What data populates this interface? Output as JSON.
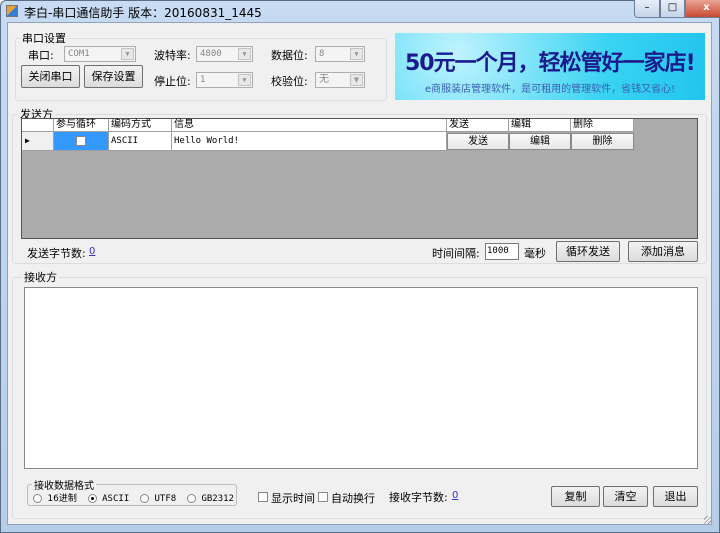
{
  "window": {
    "title": "李白-串口通信助手 版本：20160831_1445",
    "minimize": "–",
    "maximize": "□",
    "close": "x"
  },
  "serial": {
    "group_label": "串口设置",
    "port_label": "串口:",
    "port_value": "COM1",
    "baud_label": "波特率:",
    "baud_value": "4800",
    "databits_label": "数据位:",
    "databits_value": "8",
    "stopbits_label": "停止位:",
    "stopbits_value": "1",
    "parity_label": "校验位:",
    "parity_value": "无",
    "close_port": "关闭串口",
    "save_settings": "保存设置"
  },
  "banner": {
    "headline": "50元一个月，轻松管好一家店!",
    "subline": "e商服装店管理软件，是可租用的管理软件，省钱又省心!"
  },
  "send": {
    "group_label": "发送方",
    "columns": [
      "参与循环",
      "编码方式",
      "信息",
      "发送",
      "编辑",
      "删除"
    ],
    "rows": [
      {
        "loop": false,
        "encoding": "ASCII",
        "message": "Hello World!",
        "send": "发送",
        "edit": "编辑",
        "delete": "删除"
      }
    ],
    "bytes_label": "发送字节数:",
    "bytes_value": "0",
    "interval_label": "时间间隔:",
    "interval_value": "1000",
    "ms_label": "毫秒",
    "loop_send": "循环发送",
    "add_message": "添加消息"
  },
  "receive": {
    "group_label": "接收方",
    "content": "",
    "format_label": "接收数据格式",
    "formats": [
      "16进制",
      "ASCII",
      "UTF8",
      "GB2312"
    ],
    "selected_format": "ASCII",
    "show_time": "显示时间",
    "auto_wrap": "自动换行",
    "bytes_label": "接收字节数:",
    "bytes_value": "0",
    "copy": "复制",
    "clear": "清空",
    "exit": "退出"
  },
  "colors": {
    "grid_selection": "#3399ff",
    "grid_bg": "#ababab",
    "link": "#3333cc",
    "banner_text": "#1a1a8c"
  }
}
